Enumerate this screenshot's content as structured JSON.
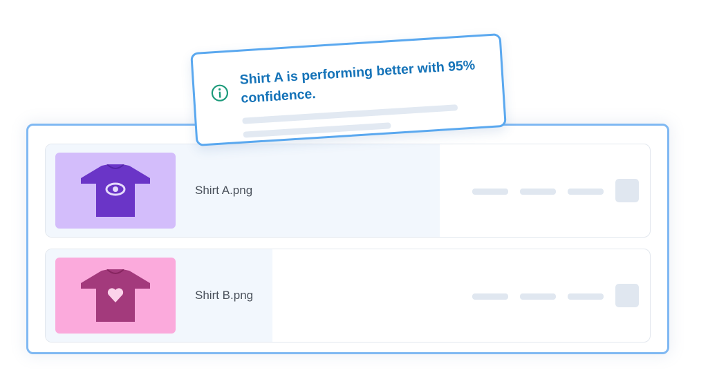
{
  "notification": {
    "message": "Shirt A is performing better with 95% confidence.",
    "icon": "info-icon",
    "accent_color": "#1573b8"
  },
  "variants": [
    {
      "filename": "Shirt A.png",
      "thumbnail_icon": "tshirt-eye-icon",
      "thumbnail_bg": "#d3bdfb",
      "shirt_color": "#6a35c7",
      "performance_share": 0.65
    },
    {
      "filename": "Shirt B.png",
      "thumbnail_icon": "tshirt-heart-icon",
      "thumbnail_bg": "#fbaadc",
      "shirt_color": "#a33a7c",
      "performance_share": 0.37
    }
  ]
}
